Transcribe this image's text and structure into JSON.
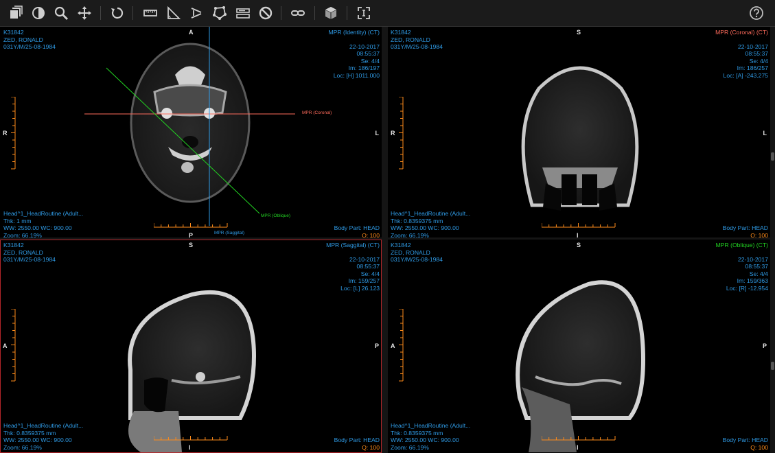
{
  "toolbar": {
    "left_icons": [
      "layers-icon",
      "contrast-icon",
      "zoom-icon",
      "pan-icon",
      "reset-icon",
      "ruler-icon",
      "angle-icon",
      "cobb-angle-icon",
      "roi-icon",
      "annotation-icon",
      "clear-icon",
      "link-icon",
      "3d-cube-icon",
      "fullscreen-icon"
    ],
    "help_icon": "help-icon"
  },
  "colors": {
    "overlay": "#2f9be6",
    "coronal": "#ff6b5c",
    "oblique": "#22d422",
    "sagittal_line": "#2f9be6",
    "quality": "#ff8c1a",
    "active_border": "#b3262a"
  },
  "viewports": [
    {
      "patient_id": "K31842",
      "patient_name": "ZED, RONALD",
      "patient_info": "031Y/M/25-08-1984",
      "title": "MPR (Identity) (CT)",
      "date": "22-10-2017",
      "time": "08:55:37",
      "series": "Se: 4/4",
      "image": "Im: 186/197",
      "location": "Loc: [H] 1011.000",
      "description": "Head^1_HeadRoutine (Adult...",
      "thickness": "Thk: 1 mm",
      "window": "WW: 2550.00 WC: 900.00",
      "zoom": "Zoom: 66.19%",
      "body_part": "Body Part: HEAD",
      "quality": "Q: 100",
      "orient_top": "A",
      "orient_left": "R",
      "orient_right": "L",
      "orient_bottom": "P",
      "ref_coronal": "MPR (Coronal)",
      "ref_oblique": "MPR (Oblique)",
      "ref_sagittal": "MPR (Saggital)"
    },
    {
      "patient_id": "K31842",
      "patient_name": "ZED, RONALD",
      "patient_info": "031Y/M/25-08-1984",
      "title": "MPR (Coronal) (CT)",
      "date": "22-10-2017",
      "time": "08:55:37",
      "series": "Se: 4/4",
      "image": "Im: 186/257",
      "location": "Loc: [A] -243.275",
      "description": "Head^1_HeadRoutine (Adult...",
      "thickness": "Thk: 0.8359375 mm",
      "window": "WW: 2550.00 WC: 900.00",
      "zoom": "Zoom: 66.19%",
      "body_part": "Body Part: HEAD",
      "quality": "Q: 100",
      "orient_top": "S",
      "orient_left": "R",
      "orient_right": "L",
      "orient_bottom": "I"
    },
    {
      "patient_id": "K31842",
      "patient_name": "ZED, RONALD",
      "patient_info": "031Y/M/25-08-1984",
      "title": "MPR (Saggital) (CT)",
      "date": "22-10-2017",
      "time": "08:55:37",
      "series": "Se: 4/4",
      "image": "Im: 159/257",
      "location": "Loc: [L] 26.123",
      "description": "Head^1_HeadRoutine (Adult...",
      "thickness": "Thk: 0.8359375 mm",
      "window": "WW: 2550.00 WC: 900.00",
      "zoom": "Zoom: 66.19%",
      "body_part": "Body Part: HEAD",
      "quality": "Q: 100",
      "orient_top": "S",
      "orient_left": "A",
      "orient_right": "P",
      "orient_bottom": "I"
    },
    {
      "patient_id": "K31842",
      "patient_name": "ZED, RONALD",
      "patient_info": "031Y/M/25-08-1984",
      "title": "MPR (Oblique) (CT)",
      "date": "22-10-2017",
      "time": "08:55:37",
      "series": "Se: 4/4",
      "image": "Im: 159/363",
      "location": "Loc: [R] -12.954",
      "description": "Head^1_HeadRoutine (Adult...",
      "thickness": "Thk: 0.8359375 mm",
      "window": "WW: 2550.00 WC: 900.00",
      "zoom": "Zoom: 66.19%",
      "body_part": "Body Part: HEAD",
      "quality": "Q: 100",
      "orient_top": "S",
      "orient_left": "A",
      "orient_right": "P",
      "orient_bottom": "I"
    }
  ]
}
